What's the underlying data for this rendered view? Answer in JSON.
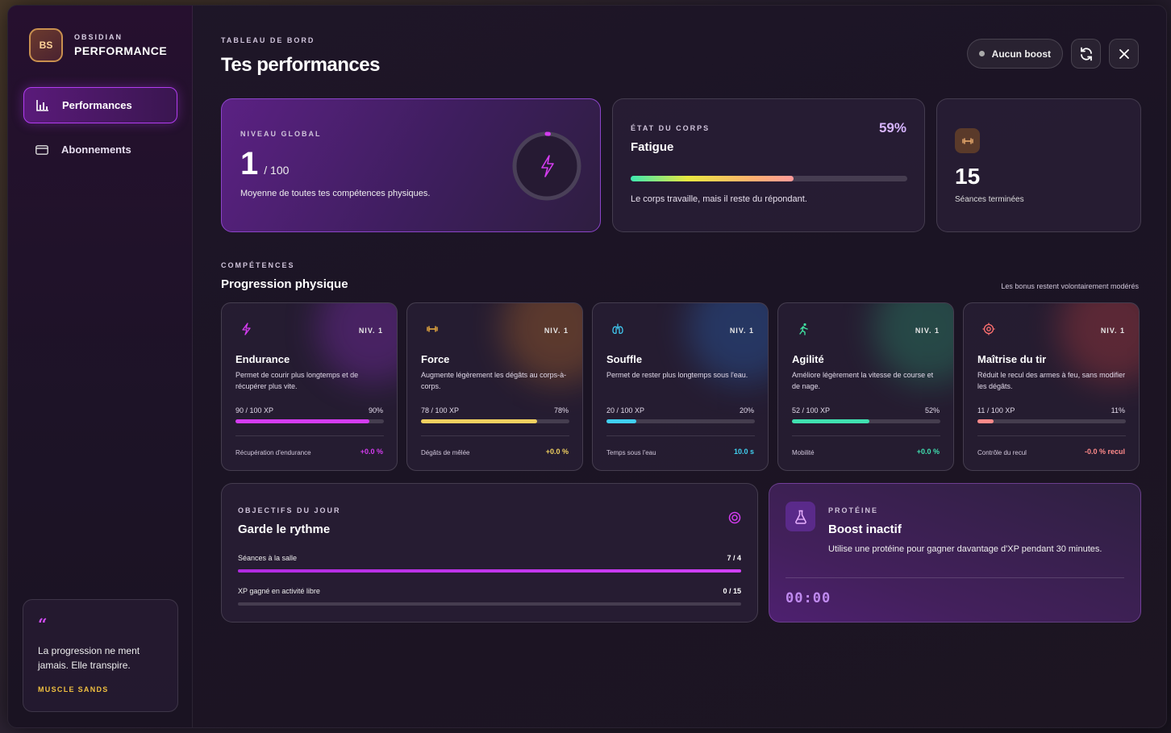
{
  "brand": {
    "logo": "BS",
    "subtitle": "OBSIDIAN",
    "title": "PERFORMANCE"
  },
  "nav": [
    {
      "label": "Performances",
      "icon": "bar-chart-icon",
      "active": true
    },
    {
      "label": "Abonnements",
      "icon": "credit-card-icon",
      "active": false
    }
  ],
  "quote": {
    "mark": "“",
    "text": "La progression ne ment jamais. Elle transpire.",
    "author": "MUSCLE SANDS"
  },
  "header": {
    "eyebrow": "TABLEAU DE BORD",
    "title": "Tes performances",
    "boost_label": "Aucun boost"
  },
  "level": {
    "eyebrow": "NIVEAU GLOBAL",
    "value": "1",
    "max": "/ 100",
    "desc": "Moyenne de toutes tes compétences physiques.",
    "progress": 0.01
  },
  "body_state": {
    "eyebrow": "ÉTAT DU CORPS",
    "state": "Fatigue",
    "percent": "59%",
    "fill": 0.59,
    "desc": "Le corps travaille, mais il reste du répondant."
  },
  "sessions": {
    "count": "15",
    "label": "Séances terminées"
  },
  "skills_section": {
    "eyebrow": "COMPÉTENCES",
    "title": "Progression physique",
    "note": "Les bonus restent volontairement modérés"
  },
  "skills": [
    {
      "name": "Endurance",
      "level": "NIV. 1",
      "desc": "Permet de courir plus longtemps et de récupérer plus vite.",
      "xp": "90 / 100 XP",
      "pct": "90%",
      "fill": 0.9,
      "stat": "Récupération d'endurance",
      "value": "+0.0 %",
      "color": "#d43cf0",
      "icon": "lightning-icon"
    },
    {
      "name": "Force",
      "level": "NIV. 1",
      "desc": "Augmente légèrement les dégâts au corps-à-corps.",
      "xp": "78 / 100 XP",
      "pct": "78%",
      "fill": 0.78,
      "stat": "Dégâts de mêlée",
      "value": "+0.0 %",
      "color": "#f0d060",
      "icon": "dumbbell-icon"
    },
    {
      "name": "Souffle",
      "level": "NIV. 1",
      "desc": "Permet de rester plus longtemps sous l'eau.",
      "xp": "20 / 100 XP",
      "pct": "20%",
      "fill": 0.2,
      "stat": "Temps sous l'eau",
      "value": "10.0 s",
      "color": "#40d0f0",
      "icon": "lungs-icon"
    },
    {
      "name": "Agilité",
      "level": "NIV. 1",
      "desc": "Améliore légèrement la vitesse de course et de nage.",
      "xp": "52 / 100 XP",
      "pct": "52%",
      "fill": 0.52,
      "stat": "Mobilité",
      "value": "+0.0 %",
      "color": "#40e0b0",
      "icon": "running-icon"
    },
    {
      "name": "Maîtrise du tir",
      "level": "NIV. 1",
      "desc": "Réduit le recul des armes à feu, sans modifier les dégâts.",
      "xp": "11 / 100 XP",
      "pct": "11%",
      "fill": 0.11,
      "stat": "Contrôle du recul",
      "value": "-0.0 % recul",
      "color": "#ff8a8a",
      "icon": "target-icon"
    }
  ],
  "goals": {
    "eyebrow": "OBJECTIFS DU JOUR",
    "title": "Garde le rythme",
    "items": [
      {
        "label": "Séances à la salle",
        "value": "7 / 4",
        "fill": 1.0
      },
      {
        "label": "XP gagné en activité libre",
        "value": "0 / 15",
        "fill": 0.0
      }
    ]
  },
  "protein": {
    "eyebrow": "PROTÉINE",
    "title": "Boost inactif",
    "desc": "Utilise une protéine pour gagner davantage d'XP pendant 30 minutes.",
    "timer": "00:00"
  }
}
